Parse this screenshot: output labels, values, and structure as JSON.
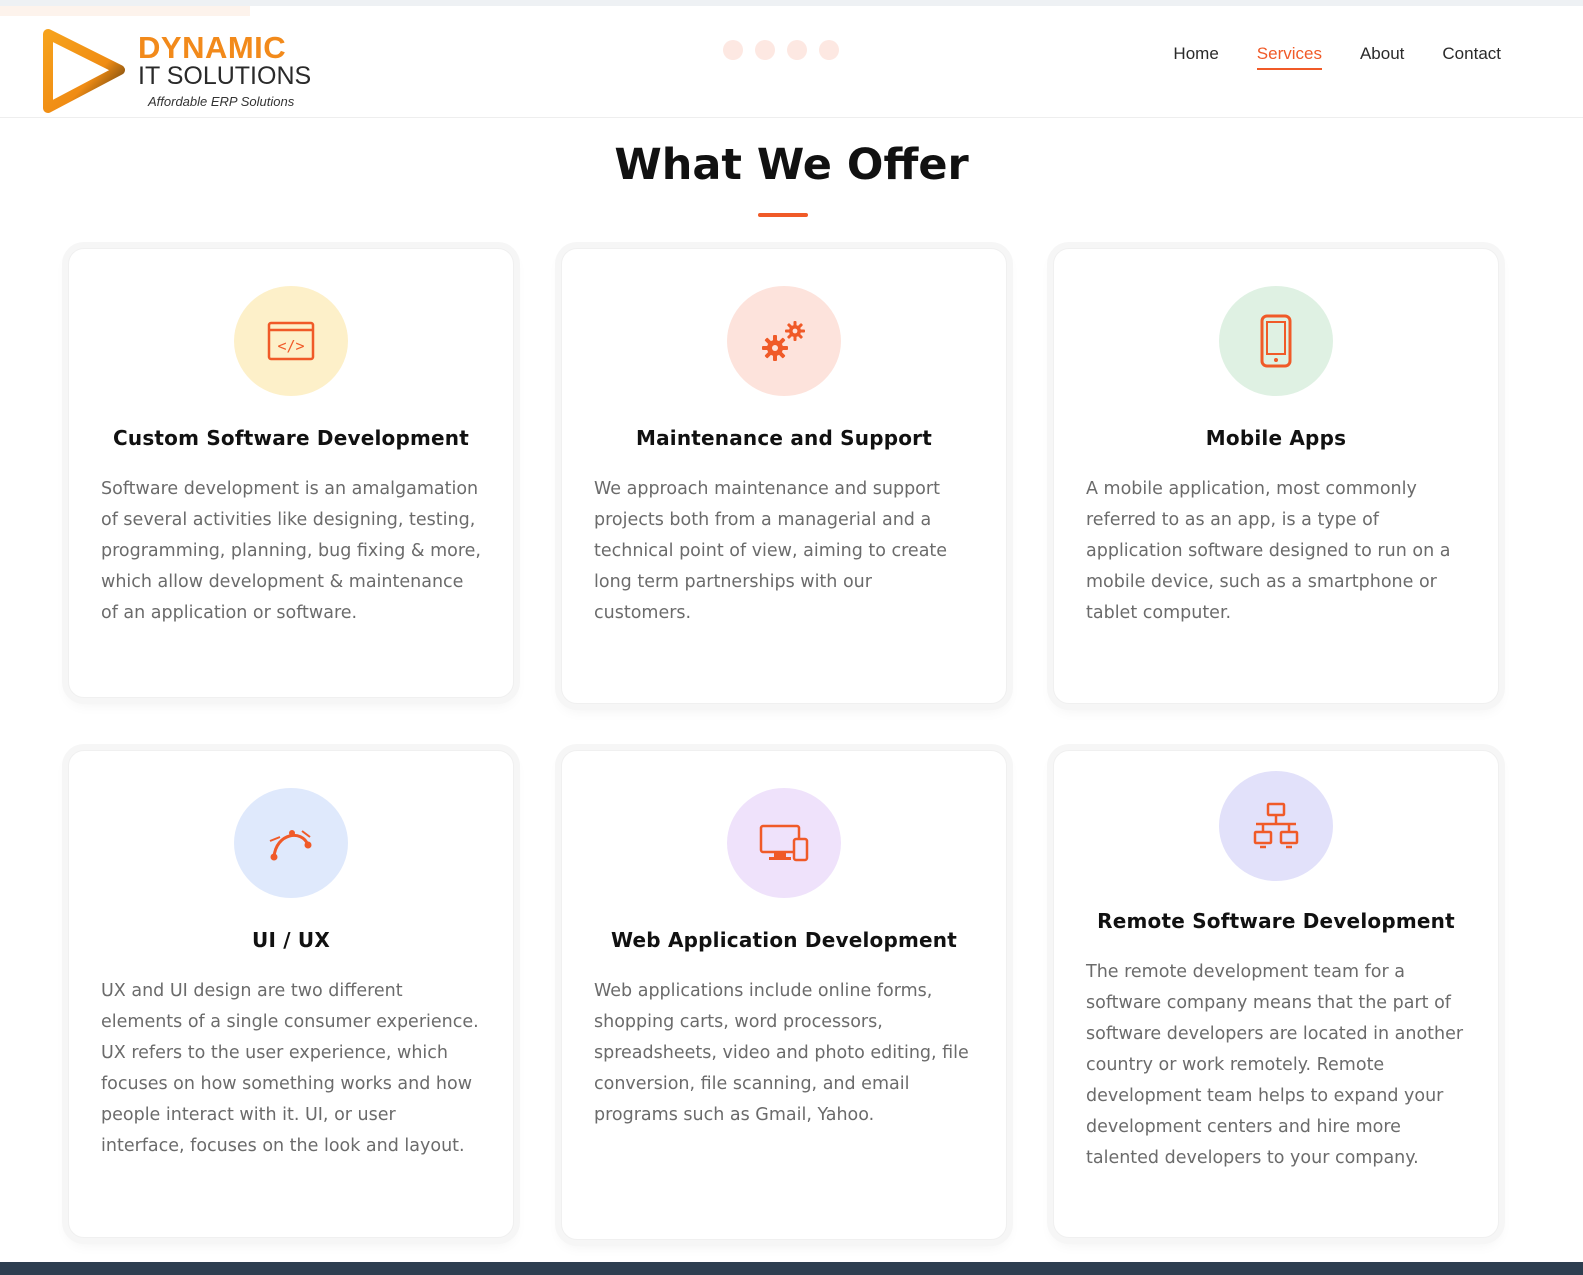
{
  "header": {
    "logo": {
      "line1": "DYNAMIC",
      "line2": "IT SOLUTIONS",
      "tagline": "Affordable ERP Solutions"
    },
    "nav": [
      {
        "label": "Home",
        "active": false
      },
      {
        "label": "Services",
        "active": true
      },
      {
        "label": "About",
        "active": false
      },
      {
        "label": "Contact",
        "active": false
      }
    ]
  },
  "section": {
    "title": "What We Offer"
  },
  "services": [
    {
      "icon": "code-window-icon",
      "icon_bg": "#fdf0c9",
      "title": "Custom Software Development",
      "text": "Software development is an amalgamation of several activities like designing, testing, programming, planning, bug fixing & more, which allow development & maintenance of an application or software."
    },
    {
      "icon": "gears-icon",
      "icon_bg": "#fde3dc",
      "title": "Maintenance and Support",
      "text": "We approach maintenance and support projects both from a managerial and a technical point of view, aiming to create long term partnerships with our customers."
    },
    {
      "icon": "mobile-phone-icon",
      "icon_bg": "#dff1e3",
      "title": "Mobile Apps",
      "text": "A mobile application, most commonly referred to as an app, is a type of application software designed to run on a mobile device, such as a smartphone or tablet computer."
    },
    {
      "icon": "bezier-curve-icon",
      "icon_bg": "#dfe9fc",
      "title": "UI / UX",
      "text": "UX and UI design are two different elements of a single consumer experience. UX refers to the user experience, which focuses on how something works and how people interact with it. UI, or user interface, focuses on the look and layout."
    },
    {
      "icon": "monitor-devices-icon",
      "icon_bg": "#efe2fb",
      "title": "Web Application Development",
      "text": "Web applications include online forms, shopping carts, word processors, spreadsheets, video and photo editing, file conversion, file scanning, and email programs such as Gmail, Yahoo."
    },
    {
      "icon": "network-icon",
      "icon_bg": "#e2e1fa",
      "title": "Remote Software Development",
      "text": "The remote development team for a software company means that the part of software developers are located in another country or work remotely. Remote development team helps to expand your development centers and hire more talented developers to your company."
    }
  ],
  "colors": {
    "accent": "#f05a28",
    "brand_orange": "#f28a1b",
    "footer_bar": "#2d3e50"
  }
}
